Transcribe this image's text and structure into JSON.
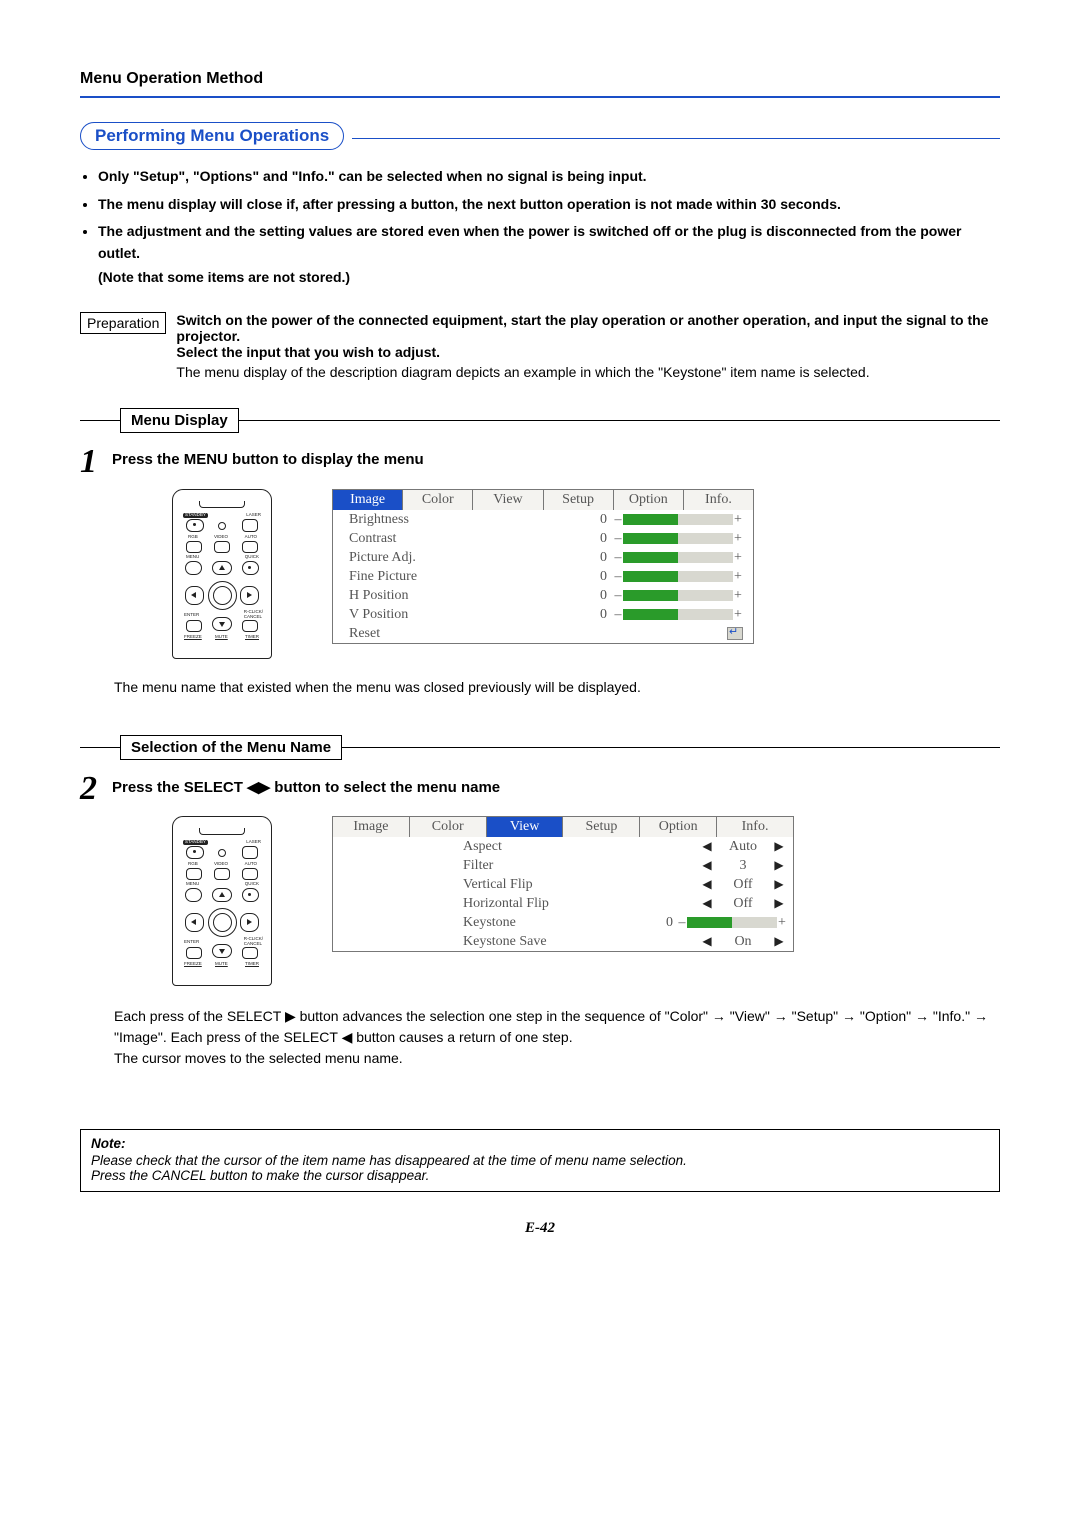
{
  "header": "Menu Operation Method",
  "section_title": "Performing Menu Operations",
  "bullets": [
    "Only \"Setup\", \"Options\" and \"Info.\" can be selected when no signal is being input.",
    "The menu display will close if, after pressing a button, the next button operation is not made within 30 seconds.",
    "The adjustment and the setting values are stored even when the power is switched off or the plug is disconnected from the power outlet."
  ],
  "bullet3_sub": "(Note that some items are not stored.)",
  "prep_label": "Preparation",
  "prep_bold1": "Switch on the power of the connected equipment, start the play operation or another operation, and input the signal to the projector.",
  "prep_bold2": "Select the input that you wish to adjust.",
  "prep_normal": "The menu display of the description diagram depicts an example in which the \"Keystone\" item name is selected.",
  "sub1_title": "Menu Display",
  "step1_num": "1",
  "step1_text": "Press the MENU button to display the menu",
  "remote_labels": {
    "standby": "STANDBY",
    "laser": "LASER",
    "rgb": "RGB",
    "video": "VIDEO",
    "auto": "AUTO",
    "menu": "MENU",
    "quick": "QUICK",
    "enter": "ENTER",
    "rclick": "R-CLICK/",
    "cancel": "CANCEL",
    "freeze": "FREEZE",
    "mute": "MUTE",
    "timer": "TIMER"
  },
  "menu1": {
    "tabs": [
      "Image",
      "Color",
      "View",
      "Setup",
      "Option",
      "Info."
    ],
    "active_tab": 0,
    "rows": [
      {
        "label": "Brightness",
        "val": "0"
      },
      {
        "label": "Contrast",
        "val": "0"
      },
      {
        "label": "Picture Adj.",
        "val": "0"
      },
      {
        "label": "Fine Picture",
        "val": "0"
      },
      {
        "label": "H Position",
        "val": "0"
      },
      {
        "label": "V Position",
        "val": "0"
      }
    ],
    "reset": "Reset"
  },
  "caption1": "The menu name that existed when the menu was closed previously will be displayed.",
  "sub2_title": "Selection of the Menu Name",
  "step2_num": "2",
  "step2_text": "Press the SELECT ◀▶ button to select the menu name",
  "menu2": {
    "tabs": [
      "Image",
      "Color",
      "View",
      "Setup",
      "Option",
      "Info."
    ],
    "active_tab": 2,
    "rows": [
      {
        "label": "Aspect",
        "value": "Auto",
        "type": "enum"
      },
      {
        "label": "Filter",
        "value": "3",
        "type": "enum"
      },
      {
        "label": "Vertical Flip",
        "value": "Off",
        "type": "enum"
      },
      {
        "label": "Horizontal Flip",
        "value": "Off",
        "type": "enum"
      },
      {
        "label": "Keystone",
        "value": "0",
        "type": "slider"
      },
      {
        "label": "Keystone Save",
        "value": "On",
        "type": "enum"
      }
    ]
  },
  "para2_line1": "Each press of the SELECT ▶ button advances the selection one step in the sequence of \"Color\" → \"View\" → \"Setup\" → \"Option\" → \"Info.\" → \"Image\". Each press of the SELECT ◀ button causes a return of one step.",
  "para2_line2": "The cursor moves to the selected menu name.",
  "note_title": "Note:",
  "note_line1": "Please check that the cursor of the item name has disappeared at the time of menu name selection.",
  "note_line2": "Press the CANCEL button to make the cursor disappear.",
  "page_number": "E-42"
}
